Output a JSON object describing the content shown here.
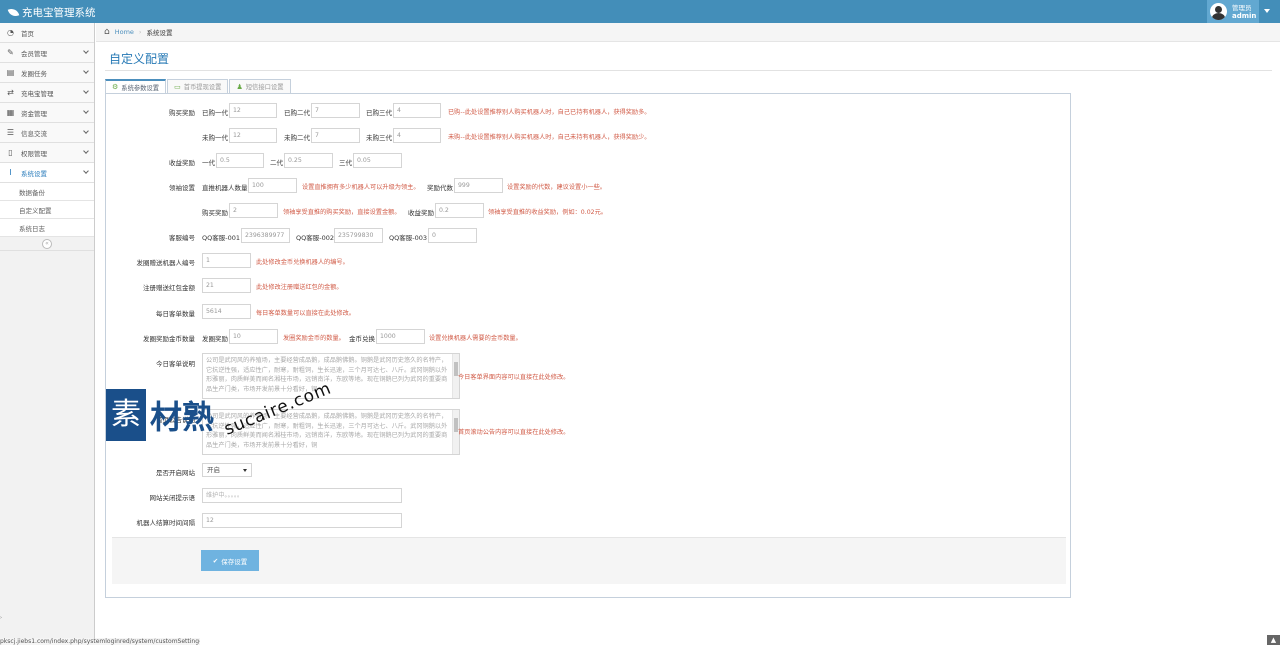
{
  "app": {
    "title": "充电宝管理系统"
  },
  "user": {
    "role": "管理员",
    "name": "admin"
  },
  "sidebar": {
    "items": [
      {
        "label": "首页",
        "icon": "dashboard-icon",
        "glyph": "◔"
      },
      {
        "label": "会员管理",
        "icon": "edit-icon",
        "glyph": "✎"
      },
      {
        "label": "发圈任务",
        "icon": "book-icon",
        "glyph": "▤"
      },
      {
        "label": "充电宝管理",
        "icon": "random-icon",
        "glyph": "⇄"
      },
      {
        "label": "资金管理",
        "icon": "calendar-icon",
        "glyph": "▦"
      },
      {
        "label": "信息交流",
        "icon": "list-icon",
        "glyph": "☰"
      },
      {
        "label": "权限管理",
        "icon": "file-icon",
        "glyph": "▯"
      },
      {
        "label": "系统设置",
        "icon": "text-width-icon",
        "glyph": "Ⅰ"
      }
    ],
    "subitems": [
      "数据备份",
      "自定义配置",
      "系统日志"
    ]
  },
  "breadcrumb": {
    "home": "Home",
    "current": "系统设置"
  },
  "page": {
    "title": "自定义配置"
  },
  "tabs": [
    "系统参数设置",
    "首币提现设置",
    "短信接口设置"
  ],
  "form": {
    "purchase_reward": {
      "label": "购买奖励",
      "row1": {
        "l1": "已购一代",
        "v1": "12",
        "l2": "已购二代",
        "v2": "7",
        "l3": "已购三代",
        "v3": "4",
        "hint": "已购--此处设置推荐别人购买机器人时，自己已持有机器人，获得奖励多。"
      },
      "row2": {
        "l1": "未购一代",
        "v1": "12",
        "l2": "未购二代",
        "v2": "7",
        "l3": "未购三代",
        "v3": "4",
        "hint": "未购--此处设置推荐别人购买机器人时，自己未持有机器人，获得奖励少。"
      }
    },
    "income_reward": {
      "label": "收益奖励",
      "l1": "一代",
      "v1": "0.5",
      "l2": "二代",
      "v2": "0.25",
      "l3": "三代",
      "v3": "0.05"
    },
    "leader_settings": {
      "label": "领袖设置",
      "direct_label": "直推机器人数量",
      "direct_value": "100",
      "direct_hint": "设置直推拥有多少机器人可以升级为领主。",
      "gen_label": "奖励代数",
      "gen_value": "999",
      "gen_hint": "设置奖励的代数，建议设置小一些。",
      "buy_label": "购买奖励",
      "buy_value": "2",
      "buy_hint": "领袖享受直推的购买奖励，直接设置金额。",
      "income_label": "收益奖励",
      "income_value": "0.2",
      "income_hint": "领袖享受直推的收益奖励，例如：0.02元。"
    },
    "service": {
      "label": "客服编号",
      "l1": "QQ客服-001",
      "v1": "2396389977",
      "l2": "QQ客服-002",
      "v2": "235799830",
      "l3": "QQ客服-003",
      "v3": "0"
    },
    "gift_robot": {
      "label": "发圈赠送机器人编号",
      "value": "1",
      "hint": "此处修改金币兑换机器人的编号。"
    },
    "reg_redpack": {
      "label": "注册赠送红包金额",
      "value": "21",
      "hint": "此处修改注册赠送红包的金额。"
    },
    "daily_orders": {
      "label": "每日客单数量",
      "value": "5614",
      "hint": "每日客单数量可以直接在此处修改。"
    },
    "coin_reward": {
      "label": "发圈奖励金币数量",
      "l1": "发圈奖励",
      "v1": "10",
      "h1": "发圈奖励金币的数量。",
      "l2": "金币兑换",
      "v2": "1000",
      "h2": "设置兑换机器人需要的金币数量。"
    },
    "today_desc": {
      "label": "今日客单说明",
      "text": "公司是武冈风的养殖场，主要经营成品鹅，成品鹅佛鹅。铜鹅是武冈历史悠久的名特产，它抗逆性强，适应性广，耐寒，耐粗饲，生长迅速，三个月可达七、八斤。武冈铜鹅以外形雅丽，肉质鲜美而闻名湘桂市场，远销南洋，东欧等地。现在铜鹅已列为武冈的重要商品生产门类，市场开发前景十分看好，铜",
      "hint": "今日客单界面内容可以直接在此处修改。"
    },
    "notice_desc": {
      "label": "首页公告说明",
      "text": "公司是武冈风的养殖场，主要经营成品鹅，成品鹅佛鹅。铜鹅是武冈历史悠久的名特产，它抗逆性强，适应性广，耐寒，耐粗饲，生长迅速，三个月可达七、八斤。武冈铜鹅以外形雅丽，肉质鲜美而闻名湘桂市场，远销南洋，东欧等地。现在铜鹅已列为武冈的重要商品生产门类，市场开发前景十分看好，铜",
      "hint": "首页滚动公告内容可以直接在此处修改。"
    },
    "site_open": {
      "label": "是否开启网站",
      "value": "开启"
    },
    "close_tip": {
      "label": "网站关闭提示语",
      "placeholder": "维护中。。。。。"
    },
    "robot_interval": {
      "label": "机器人结算时间间隔",
      "value": "12"
    },
    "save_label": "保存设置"
  },
  "watermark": {
    "cn": "素材熟",
    "url": "sucaire.com"
  },
  "status_url": "pkscj.jiebs1.com/index.php/systemloginred/system/customSetting#"
}
